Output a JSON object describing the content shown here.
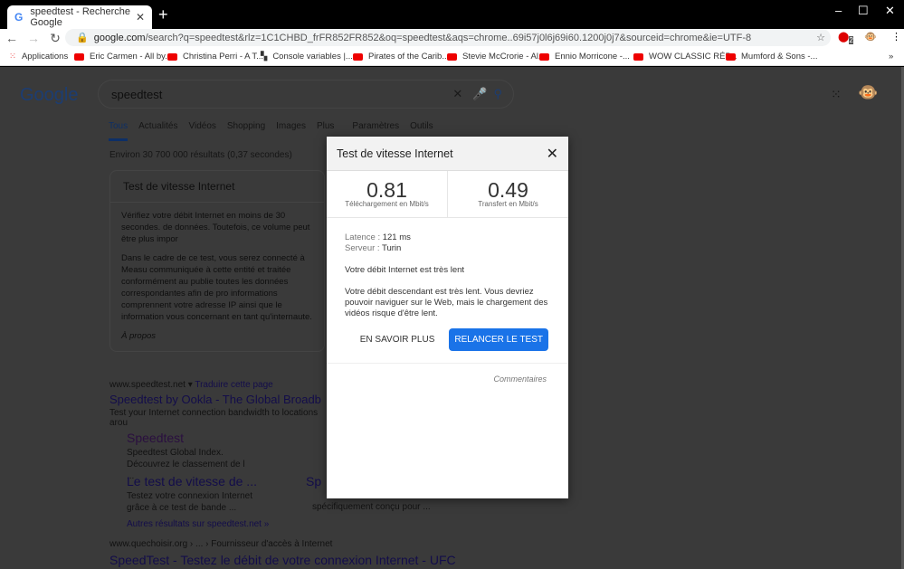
{
  "browser": {
    "tab_title": "speedtest - Recherche Google",
    "url_host": "google.com",
    "url_rest": "/search?q=speedtest&rlz=1C1CHBD_frFR852FR852&oq=speedtest&aqs=chrome..69i57j0l6j69i60.1200j0j7&sourceid=chrome&ie=UTF-8",
    "ext_badge": "2"
  },
  "bookmarks": [
    "Applications",
    "Eric Carmen - All by...",
    "Christina Perri - A T...",
    "Console variables |...",
    "Pirates of the Carib...",
    "Stevie McCrorie - Al...",
    "Ennio Morricone -...",
    "WOW CLASSIC RÉP...",
    "Mumford & Sons -..."
  ],
  "google": {
    "logo": "Google",
    "query": "speedtest",
    "tabs": [
      "Tous",
      "Actualités",
      "Vidéos",
      "Shopping",
      "Images",
      "Plus",
      "Paramètres",
      "Outils"
    ],
    "result_count": "Environ 30 700 000 résultats (0,37 secondes)"
  },
  "card": {
    "title": "Test de vitesse Internet",
    "p1": "Vérifiez votre débit Internet en moins de 30 secondes. de données. Toutefois, ce volume peut être plus impor",
    "p2": "Dans le cadre de ce test, vous serez connecté à Measu communiquée à cette entité et traitée conformément au publie toutes les données correspondantes afin de pro informations comprennent votre adresse IP ainsi que le information vous concernant en tant qu'internaute.",
    "about": "À propos"
  },
  "results": {
    "site1": "www.speedtest.net",
    "translate": "Traduire cette page",
    "title1": "Speedtest by Ookla - The Global Broadb",
    "desc1": "Test your Internet connection bandwidth to locations arou",
    "sub1": "Speedtest",
    "sub1d": "Speedtest Global Index. Découvrez le classement de l ...",
    "sub2": "Le test de vitesse de ...",
    "sub2d": "Testez votre connexion Internet grâce à ce test de bande ...",
    "sub3": "Sp",
    "sub3d": "spécifiquement conçu pour ...",
    "more": "Autres résultats sur speedtest.net »",
    "site2": "www.quechoisir.org › ... › Fournisseur d'accès à Internet",
    "title2": "SpeedTest - Testez le débit de votre connexion Internet - UFC"
  },
  "modal": {
    "title": "Test de vitesse Internet",
    "download": "0.81",
    "download_label": "Téléchargement en Mbit/s",
    "upload": "0.49",
    "upload_label": "Transfert en Mbit/s",
    "latency_label": "Latence :",
    "latency": "121 ms",
    "server_label": "Serveur :",
    "server": "Turin",
    "headline": "Votre débit Internet est très lent",
    "detail": "Votre débit descendant est très lent. Vous devriez pouvoir naviguer sur le Web, mais le chargement des vidéos risque d'être lent.",
    "learn_more": "EN SAVOIR PLUS",
    "retry": "RELANCER LE TEST",
    "feedback": "Commentaires"
  }
}
